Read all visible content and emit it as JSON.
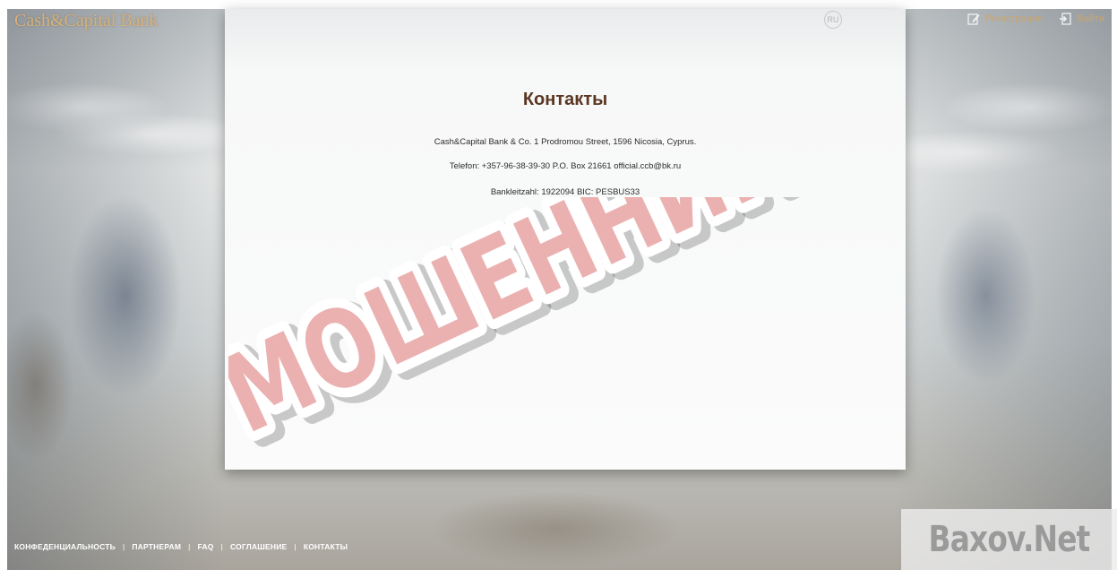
{
  "header": {
    "brand": "Cash&Capital Bank",
    "register_label": "Регистрация",
    "login_label": "Войти",
    "lang": "RU"
  },
  "content": {
    "title": "Контакты",
    "address": "Cash&Capital Bank & Co. 1 Prodromou Street, 1596 Nicosia, Cyprus.",
    "phone_line": "Telefon: +357-96-38-39-30 P.O. Box 21661 official.ccb@bk.ru",
    "bank_line": "Bankleitzahl: 1922094 BIC: PESBUS33"
  },
  "overlay": {
    "stamp_text": "МОШЕННИКИ",
    "stamp_color": "#e8a3a3",
    "watermark": "Baxov.Net"
  },
  "footer": {
    "links": [
      "КОНФЕДЕНЦИАЛЬНОСТЬ",
      "ПАРТНЕРАМ",
      "FAQ",
      "СОГЛАШЕНИЕ",
      "КОНТАКТЫ"
    ]
  },
  "colors": {
    "brand": "#d8b27a",
    "title": "#5b3722"
  }
}
